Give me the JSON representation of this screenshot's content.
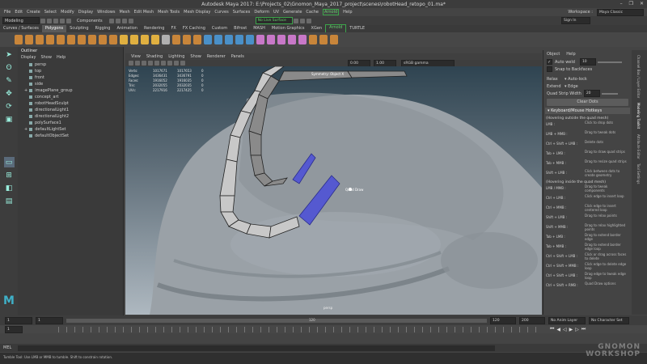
{
  "window": {
    "title": "Autodesk Maya 2017: E:\\Projects_02\\Gnomon_Maya_2017_project\\scenes\\robotHead_retopo_01.ma*",
    "controls": [
      "–",
      "❐",
      "✕"
    ]
  },
  "menubar": {
    "items": [
      "File",
      "Edit",
      "Create",
      "Select",
      "Modify",
      "Display",
      "Windows",
      "Mesh",
      "Edit Mesh",
      "Mesh Tools",
      "Mesh Display",
      "Curves",
      "Surfaces",
      "Deform",
      "UV",
      "Generate",
      "Cache",
      "Arnold",
      "Help"
    ],
    "highlighted": "Arnold",
    "workspace_label": "Workspace :",
    "workspace_value": "Maya Classic"
  },
  "statusline": {
    "mode": "Modeling",
    "components_label": "Components",
    "live_surface": "No Live Surface",
    "sign_in": "Sign In"
  },
  "shelf": {
    "tabs": [
      "Curves / Surfaces",
      "Polygons",
      "Sculpting",
      "Rigging",
      "Animation",
      "Rendering",
      "FX",
      "FX Caching",
      "Custom",
      "Bifrost",
      "MASH",
      "Motion Graphics",
      "XGen",
      "Arnold",
      "TURTLE"
    ],
    "active": "Polygons",
    "highlighted": "Arnold",
    "icon_colors": [
      "#c8853a",
      "#c8853a",
      "#c8853a",
      "#c8853a",
      "#c8853a",
      "#c8853a",
      "#c8853a",
      "#c8853a",
      "#c8853a",
      "#c8853a",
      "#e0b040",
      "#e0b040",
      "#e0b040",
      "#e0b040",
      "#b0b0b0",
      "#c8853a",
      "#c8853a",
      "#c8853a",
      "#4a90c8",
      "#4a90c8",
      "#4a90c8",
      "#4a90c8",
      "#4a90c8",
      "#c878c8",
      "#c878c8",
      "#c878c8",
      "#c878c8",
      "#c878c8",
      "#c8853a",
      "#c8853a",
      "#c8853a"
    ]
  },
  "toolbox": {
    "icons": [
      "select-icon",
      "lasso-icon",
      "paint-icon",
      "move-icon",
      "rotate-icon",
      "scale-icon",
      "layout-single-icon",
      "layout-four-icon",
      "layout-side-icon",
      "layout-grid-icon"
    ]
  },
  "outliner": {
    "title": "Outliner",
    "menu": [
      "Display",
      "Show",
      "Help"
    ],
    "items": [
      "persp",
      "top",
      "front",
      "side",
      "imagePlane_group",
      "concept_art",
      "robotHeadSculpt",
      "directionalLight1",
      "directionalLight2",
      "polySurface1",
      "defaultLightSet",
      "defaultObjectSet"
    ]
  },
  "viewport": {
    "menu": [
      "View",
      "Shading",
      "Lighting",
      "Show",
      "Renderer",
      "Panels"
    ],
    "field1": "0.00",
    "field2": "1.00",
    "colorspace": "sRGB gamma",
    "camera_label": "persp",
    "tool_label": "Quad Draw",
    "hud_label": "Symmetry: Object X",
    "hud_rows": [
      {
        "label": "Verts:",
        "a": "1017671",
        "b": "1017653",
        "c": "0"
      },
      {
        "label": "Edges:",
        "a": "3436431",
        "b": "3436791",
        "c": "0"
      },
      {
        "label": "Faces:",
        "a": "1916052",
        "b": "1916035",
        "c": "0"
      },
      {
        "label": "Tris:",
        "a": "2032055",
        "b": "2032035",
        "c": "0"
      },
      {
        "label": "UVs:",
        "a": "2217916",
        "b": "2217425",
        "c": "0"
      }
    ]
  },
  "right_panel": {
    "menu": [
      "Object",
      "Help"
    ],
    "auto_weld_label": "Auto weld",
    "auto_weld_value": "10",
    "snap_label": "Snap to Backfaces",
    "relax_label": "Relax",
    "relax_value": "Auto-lock",
    "extend_label": "Extend",
    "extend_value": "Edge",
    "quad_strip_label": "Quad Strip Width",
    "quad_strip_value": "20",
    "clear_button": "Clear Dots",
    "section_header": "Keyboard/Mouse Hotkeys",
    "hovering_outside": "(Hovering outside the quad mesh)",
    "hovering_inside": "(Hovering inside the quad mesh)",
    "hotkeys_outside": [
      {
        "key": "LMB :",
        "desc": "Click to drop dots"
      },
      {
        "key": "LMB + MMB :",
        "desc": "Drag to tweak dots"
      },
      {
        "key": "Ctrl + Shift + LMB :",
        "desc": "Delete dots"
      },
      {
        "key": "Tab + LMB :",
        "desc": "Drag to draw quad strips"
      },
      {
        "key": "Tab + MMB :",
        "desc": "Drag to resize quad strips"
      },
      {
        "key": "Shift + LMB :",
        "desc": "Click between dots to create geometry"
      }
    ],
    "hotkeys_inside": [
      {
        "key": "LMB / MMB :",
        "desc": "Drag to tweak components"
      },
      {
        "key": "Ctrl + LMB :",
        "desc": "Click edge to insert loop"
      },
      {
        "key": "Ctrl + MMB :",
        "desc": "Click edge to insert centered loop"
      },
      {
        "key": "Shift + LMB :",
        "desc": "Drag to relax points"
      },
      {
        "key": "Shift + MMB :",
        "desc": "Drag to relax highlighted points"
      },
      {
        "key": "Tab + LMB :",
        "desc": "Drag to extend border edge"
      },
      {
        "key": "Tab + MMB :",
        "desc": "Drag to extend border edge loop"
      },
      {
        "key": "Ctrl + Shift + LMB :",
        "desc": "Click or drag across faces to delete"
      },
      {
        "key": "Ctrl + Shift + MMB :",
        "desc": "Click edge to delete edge loop"
      },
      {
        "key": "Ctrl + Shift + LMB :",
        "desc": "Drag edge to tweak edge loop"
      },
      {
        "key": "Ctrl + Shift + RMB :",
        "desc": "Quad Draw options"
      }
    ]
  },
  "side_tabs": [
    "Channel Box / Layer Editor",
    "Modeling Toolkit",
    "Attribute Editor",
    "Tool Settings"
  ],
  "timeline": {
    "start": "1",
    "current": "1",
    "range_start": "1",
    "range_end": "120",
    "range_mid": "120",
    "end": "120",
    "max": "200",
    "anim_layer": "No Anim Layer",
    "char_set": "No Character Set"
  },
  "mel": {
    "label": "MEL"
  },
  "help_line": "Tumble Tool: Use LMB or MMB to tumble. Shift to constrain rotation.",
  "watermark": "GNOMON WORKSHOP",
  "logo": "M"
}
